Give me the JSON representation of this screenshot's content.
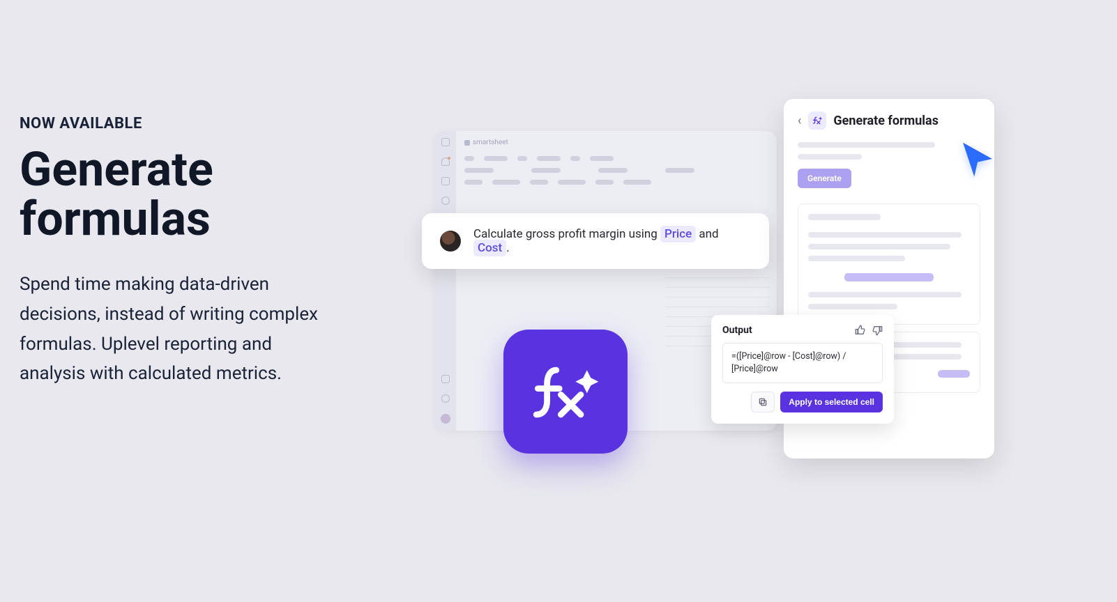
{
  "hero": {
    "eyebrow": "NOW AVAILABLE",
    "headline": "Generate formulas",
    "subcopy": "Spend time making data-driven decisions, instead of writing complex formulas. Uplevel reporting and analysis with calculated metrics."
  },
  "bg_window": {
    "brand": "smartsheet"
  },
  "prompt": {
    "text_before": "Calculate gross profit margin using ",
    "chip1": "Price",
    "mid": " and ",
    "chip2": "Cost",
    "text_after": "."
  },
  "gen_panel": {
    "title": "Generate formulas",
    "generate_label": "Generate"
  },
  "output": {
    "title": "Output",
    "formula": "=([Price]@row - [Cost]@row) / [Price]@row",
    "apply_label": "Apply to selected cell"
  }
}
